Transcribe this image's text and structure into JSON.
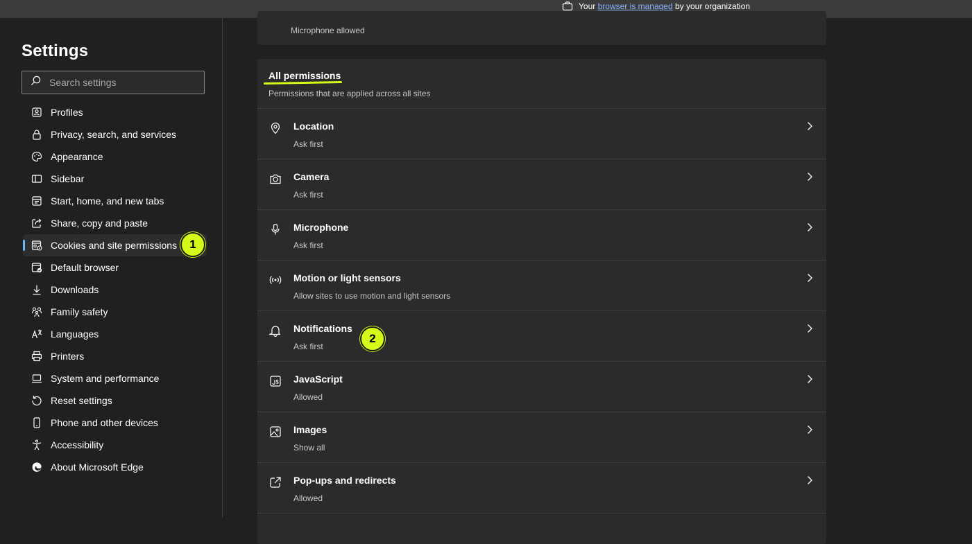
{
  "topbar": {
    "managed_prefix": "Your",
    "managed_link": "browser is managed",
    "managed_suffix": "by your organization"
  },
  "sidebar": {
    "title": "Settings",
    "search_placeholder": "Search settings",
    "items": [
      {
        "label": "Profiles",
        "icon": "profile-icon"
      },
      {
        "label": "Privacy, search, and services",
        "icon": "lock-icon"
      },
      {
        "label": "Appearance",
        "icon": "appearance-icon"
      },
      {
        "label": "Sidebar",
        "icon": "sidebar-icon"
      },
      {
        "label": "Start, home, and new tabs",
        "icon": "home-tabs-icon"
      },
      {
        "label": "Share, copy and paste",
        "icon": "share-icon"
      },
      {
        "label": "Cookies and site permissions",
        "icon": "cookies-permissions-icon"
      },
      {
        "label": "Default browser",
        "icon": "default-browser-icon"
      },
      {
        "label": "Downloads",
        "icon": "download-icon"
      },
      {
        "label": "Family safety",
        "icon": "family-icon"
      },
      {
        "label": "Languages",
        "icon": "languages-icon"
      },
      {
        "label": "Printers",
        "icon": "printer-icon"
      },
      {
        "label": "System and performance",
        "icon": "laptop-icon"
      },
      {
        "label": "Reset settings",
        "icon": "reset-icon"
      },
      {
        "label": "Phone and other devices",
        "icon": "phone-icon"
      },
      {
        "label": "Accessibility",
        "icon": "accessibility-icon"
      },
      {
        "label": "About Microsoft Edge",
        "icon": "edge-logo-icon"
      }
    ],
    "active_index": 6
  },
  "badges": {
    "one": "1",
    "two": "2",
    "color": "#d6f91a"
  },
  "main": {
    "top_card_status": "Microphone allowed",
    "all_permissions": {
      "title": "All permissions",
      "description": "Permissions that are applied across all sites",
      "rows": [
        {
          "name": "Location",
          "status": "Ask first",
          "icon": "location-pin-icon"
        },
        {
          "name": "Camera",
          "status": "Ask first",
          "icon": "camera-icon"
        },
        {
          "name": "Microphone",
          "status": "Ask first",
          "icon": "microphone-icon"
        },
        {
          "name": "Motion or light sensors",
          "status": "Allow sites to use motion and light sensors",
          "icon": "sensor-icon"
        },
        {
          "name": "Notifications",
          "status": "Ask first",
          "icon": "bell-icon"
        },
        {
          "name": "JavaScript",
          "status": "Allowed",
          "icon": "javascript-icon"
        },
        {
          "name": "Images",
          "status": "Show all",
          "icon": "image-icon"
        },
        {
          "name": "Pop-ups and redirects",
          "status": "Allowed",
          "icon": "popup-icon"
        }
      ]
    }
  },
  "colors": {
    "accent": "#6cb8f6",
    "highlight": "#d6f91a",
    "link": "#8ab4f8"
  }
}
